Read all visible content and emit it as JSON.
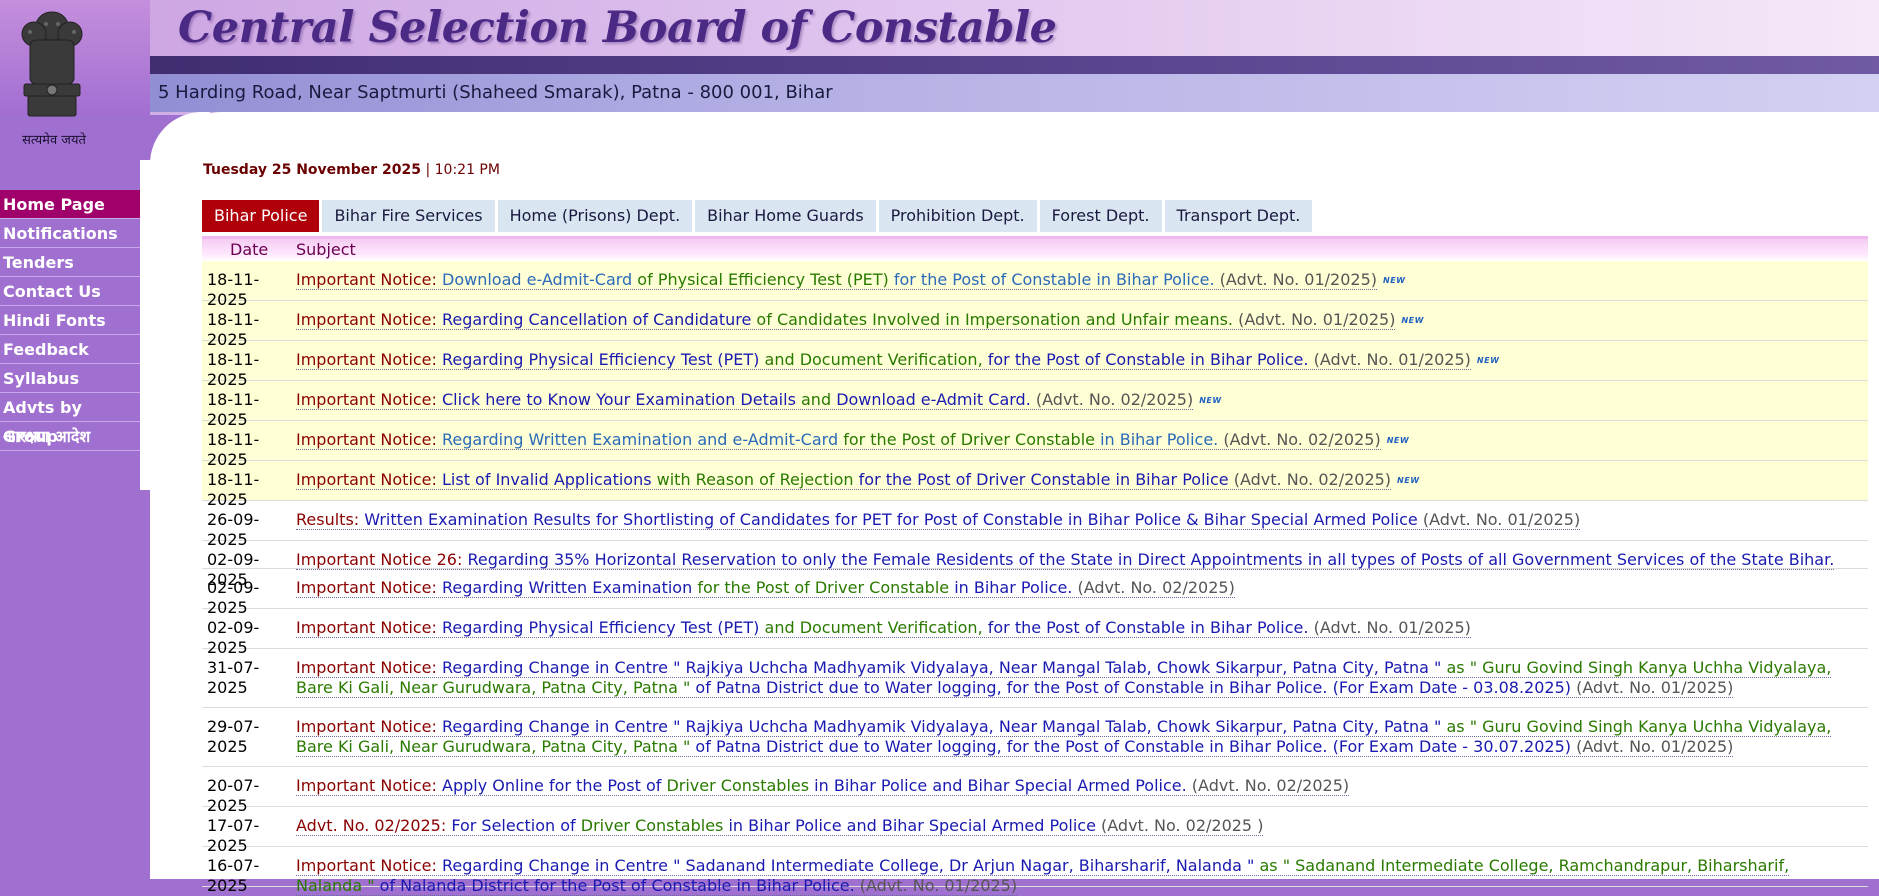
{
  "header": {
    "title": "Central Selection Board of Constable",
    "address": "5 Harding Road, Near Saptmurti (Shaheed Smarak), Patna - 800 001, Bihar",
    "motto": "सत्यमेव जयते"
  },
  "sidebar": {
    "items": [
      {
        "label": "Home Page",
        "active": true
      },
      {
        "label": "Notifications"
      },
      {
        "label": "Tenders"
      },
      {
        "label": "Contact Us"
      },
      {
        "label": "Hindi Fonts"
      },
      {
        "label": "Feedback"
      },
      {
        "label": "Syllabus"
      },
      {
        "label": "Advts by Group"
      },
      {
        "label": "आरक्षण आदेश"
      }
    ]
  },
  "dateline": {
    "date": "Tuesday 25 November 2025",
    "sep": " | ",
    "time": "10:21 PM"
  },
  "tabs": [
    {
      "label": "Bihar Police",
      "active": true
    },
    {
      "label": "Bihar Fire Services"
    },
    {
      "label": "Home (Prisons) Dept."
    },
    {
      "label": "Bihar Home Guards"
    },
    {
      "label": "Prohibition Dept."
    },
    {
      "label": "Forest Dept."
    },
    {
      "label": "Transport Dept."
    }
  ],
  "table": {
    "col_date": "Date",
    "col_subject": "Subject",
    "new_badge": "NEW",
    "rows": [
      {
        "date": "18-11-2025",
        "new": true,
        "parts": [
          [
            "maroon",
            "Important Notice: "
          ],
          [
            "lblue",
            "Download e-Admit-Card"
          ],
          [
            "green",
            " of Physical Efficiency Test (PET)"
          ],
          [
            "lblue",
            " for the Post of Constable in Bihar Police."
          ],
          [
            "gray",
            " (Advt. No. 01/2025)"
          ]
        ]
      },
      {
        "date": "18-11-2025",
        "new": true,
        "parts": [
          [
            "maroon",
            "Important Notice: "
          ],
          [
            "blue",
            "Regarding Cancellation of Candidature"
          ],
          [
            "green",
            " of Candidates Involved in Impersonation and Unfair means."
          ],
          [
            "gray",
            " (Advt. No. 01/2025)"
          ]
        ]
      },
      {
        "date": "18-11-2025",
        "new": true,
        "parts": [
          [
            "maroon",
            "Important Notice: "
          ],
          [
            "blue",
            "Regarding Physical Efficiency Test (PET)"
          ],
          [
            "green",
            " and Document Verification,"
          ],
          [
            "blue",
            " for the Post of Constable in Bihar Police."
          ],
          [
            "gray",
            " (Advt. No. 01/2025)"
          ]
        ]
      },
      {
        "date": "18-11-2025",
        "new": true,
        "parts": [
          [
            "maroon",
            "Important Notice: "
          ],
          [
            "blue",
            "Click here to Know Your Examination Details"
          ],
          [
            "green",
            " and "
          ],
          [
            "blue",
            "Download e-Admit Card."
          ],
          [
            "gray",
            " (Advt. No. 02/2025)"
          ]
        ]
      },
      {
        "date": "18-11-2025",
        "new": true,
        "parts": [
          [
            "maroon",
            "Important Notice: "
          ],
          [
            "lblue",
            "Regarding Written Examination and e-Admit-Card"
          ],
          [
            "green",
            " for the Post of Driver Constable"
          ],
          [
            "lblue",
            " in Bihar Police."
          ],
          [
            "gray",
            " (Advt. No. 02/2025)"
          ]
        ]
      },
      {
        "date": "18-11-2025",
        "new": true,
        "parts": [
          [
            "maroon",
            "Important Notice: "
          ],
          [
            "blue",
            "List of Invalid Applications"
          ],
          [
            "green",
            " with Reason of Rejection"
          ],
          [
            "blue",
            " for the Post of Driver Constable in Bihar Police"
          ],
          [
            "gray",
            " (Advt. No. 02/2025)"
          ]
        ]
      },
      {
        "date": "26-09-2025",
        "parts": [
          [
            "maroon",
            "Results: "
          ],
          [
            "blue",
            "Written Examination Results for Shortlisting of Candidates for PET for Post of Constable in Bihar Police & Bihar Special Armed Police"
          ],
          [
            "gray",
            " (Advt. No. 01/2025)"
          ]
        ]
      },
      {
        "date": "02-09-2025",
        "parts": [
          [
            "maroon",
            "Important Notice 26: "
          ],
          [
            "blue",
            "Regarding 35% Horizontal Reservation to only the Female Residents of the State in Direct Appointments in all types of Posts of all Government Services of the State Bihar."
          ]
        ]
      },
      {
        "date": "02-09-2025",
        "parts": [
          [
            "maroon",
            "Important Notice: "
          ],
          [
            "blue",
            "Regarding Written Examination"
          ],
          [
            "green",
            " for the Post of Driver Constable"
          ],
          [
            "blue",
            " in Bihar Police."
          ],
          [
            "gray",
            " (Advt. No. 02/2025)"
          ]
        ]
      },
      {
        "date": "02-09-2025",
        "parts": [
          [
            "maroon",
            "Important Notice: "
          ],
          [
            "blue",
            "Regarding Physical Efficiency Test (PET)"
          ],
          [
            "green",
            " and Document Verification,"
          ],
          [
            "blue",
            " for the Post of Constable in Bihar Police."
          ],
          [
            "gray",
            " (Advt. No. 01/2025)"
          ]
        ]
      },
      {
        "date": "31-07-2025",
        "parts": [
          [
            "maroon",
            "Important Notice: "
          ],
          [
            "blue",
            "Regarding Change in Centre \" Rajkiya Uchcha Madhyamik Vidyalaya, Near Mangal Talab, Chowk Sikarpur, Patna City, Patna \""
          ],
          [
            "green",
            " as \" Guru Govind Singh Kanya Uchha Vidyalaya, Bare Ki Gali, Near Gurudwara, Patna City, Patna \""
          ],
          [
            "blue",
            " of Patna District due to Water logging, for the Post of Constable in Bihar Police. (For Exam Date - 03.08.2025)"
          ],
          [
            "gray",
            " (Advt. No. 01/2025)"
          ]
        ]
      },
      {
        "date": "29-07-2025",
        "parts": [
          [
            "maroon",
            "Important Notice: "
          ],
          [
            "blue",
            "Regarding Change in Centre \" Rajkiya Uchcha Madhyamik Vidyalaya, Near Mangal Talab, Chowk Sikarpur, Patna City, Patna \""
          ],
          [
            "green",
            " as \" Guru Govind Singh Kanya Uchha Vidyalaya, Bare Ki Gali, Near Gurudwara, Patna City, Patna \""
          ],
          [
            "blue",
            " of Patna District due to Water logging, for the Post of Constable in Bihar Police. (For Exam Date - 30.07.2025)"
          ],
          [
            "gray",
            " (Advt. No. 01/2025)"
          ]
        ]
      },
      {
        "date": "20-07-2025",
        "parts": [
          [
            "maroon",
            "Important Notice: "
          ],
          [
            "blue",
            "Apply Online for the Post of "
          ],
          [
            "green",
            "Driver Constables"
          ],
          [
            "blue",
            " in Bihar Police and Bihar Special Armed Police."
          ],
          [
            "gray",
            " (Advt. No. 02/2025)"
          ]
        ]
      },
      {
        "date": "17-07-2025",
        "parts": [
          [
            "maroon",
            "Advt. No. 02/2025: "
          ],
          [
            "blue",
            "For Selection of "
          ],
          [
            "green",
            "Driver Constables"
          ],
          [
            "blue",
            " in Bihar Police and Bihar Special Armed Police"
          ],
          [
            "gray",
            " (Advt. No. 02/2025 )"
          ]
        ]
      },
      {
        "date": "16-07-2025",
        "parts": [
          [
            "maroon",
            "Important Notice: "
          ],
          [
            "blue",
            "Regarding Change in Centre \" Sadanand Intermediate College, Dr Arjun Nagar, Biharsharif, Nalanda \""
          ],
          [
            "green",
            " as \" Sadanand Intermediate College, Ramchandrapur, Biharsharif, Nalanda \""
          ],
          [
            "blue",
            " of Nalanda District for the Post of Constable in Bihar Police."
          ],
          [
            "gray",
            " (Advt. No. 01/2025)"
          ]
        ]
      }
    ]
  },
  "colors": {
    "brand_purple": "#a070d0",
    "active_tab": "#b0000a",
    "active_menu": "#a0006a",
    "new_row_bg": "#ffffd6"
  }
}
